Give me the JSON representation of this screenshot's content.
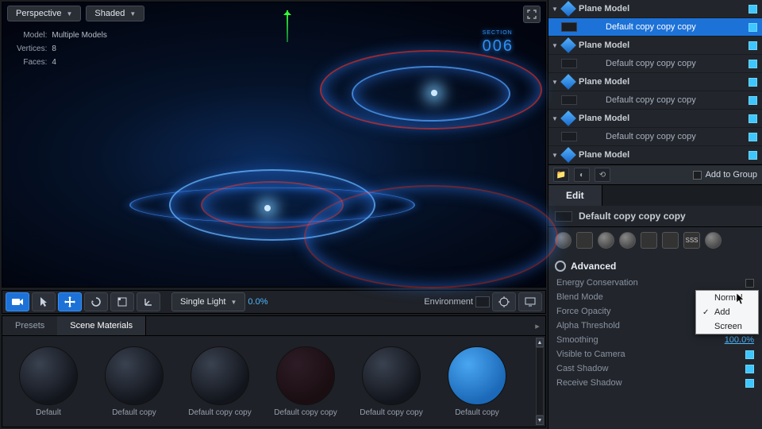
{
  "viewport": {
    "view_mode": "Perspective",
    "shade_mode": "Shaded",
    "info": {
      "model_label": "Model:",
      "model": "Multiple Models",
      "vertices_label": "Vertices:",
      "vertices": "8",
      "faces_label": "Faces:",
      "faces": "4"
    },
    "section_text": "006",
    "section_prefix": "SECTION"
  },
  "toolbar": {
    "light_mode": "Single Light",
    "light_value": "0.0%",
    "env_label": "Environment"
  },
  "materials": {
    "tabs": {
      "presets": "Presets",
      "scene": "Scene Materials"
    },
    "items": [
      {
        "label": "Default",
        "style": "dark"
      },
      {
        "label": "Default copy",
        "style": "dark"
      },
      {
        "label": "Default copy copy",
        "style": "dark"
      },
      {
        "label": "Default copy copy",
        "style": "red"
      },
      {
        "label": "Default copy copy",
        "style": "dark"
      },
      {
        "label": "Default copy",
        "style": "blue"
      }
    ]
  },
  "hierarchy": {
    "rows": [
      {
        "type": "group",
        "label": "Plane Model"
      },
      {
        "type": "child",
        "label": "Default copy copy copy",
        "selected": true
      },
      {
        "type": "group",
        "label": "Plane Model"
      },
      {
        "type": "child",
        "label": "Default copy copy copy"
      },
      {
        "type": "group",
        "label": "Plane Model"
      },
      {
        "type": "child",
        "label": "Default copy copy copy"
      },
      {
        "type": "group",
        "label": "Plane Model"
      },
      {
        "type": "child",
        "label": "Default copy copy copy"
      },
      {
        "type": "group",
        "label": "Plane Model"
      }
    ],
    "bar": {
      "add_group": "Add to Group"
    }
  },
  "editor": {
    "tab": "Edit",
    "object_name": "Default copy copy copy",
    "section_title": "Advanced",
    "props": {
      "energy": "Energy Conservation",
      "blend": "Blend Mode",
      "force": "Force Opacity",
      "alpha": "Alpha Threshold",
      "smooth": "Smoothing",
      "smooth_val": "100.0%",
      "viscam": "Visible to Camera",
      "cast": "Cast Shadow",
      "recv": "Receive Shadow"
    },
    "blend_menu": {
      "normal": "Normal",
      "add": "Add",
      "screen": "Screen"
    }
  }
}
